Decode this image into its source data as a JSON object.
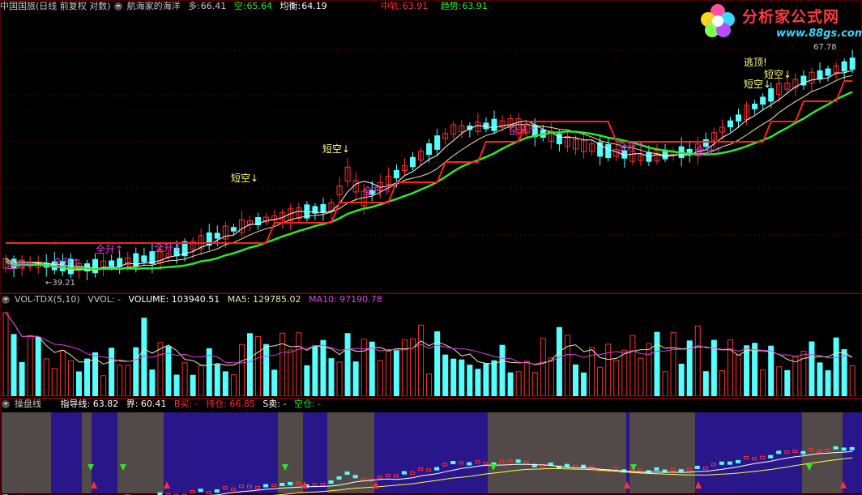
{
  "main": {
    "title": "中国国旅(日线 前复权 对数)",
    "indicator": "航海家的海洋",
    "long_label": "多:",
    "long_value": "66.41",
    "short_label": "空:",
    "short_value": "65.64",
    "balance_label": "均衡:",
    "balance_value": "64.19",
    "mid_label": "中轨:",
    "mid_value": "63.91",
    "trend_label": "趋势:",
    "trend_value": "63.91",
    "price_high": "67.78",
    "price_low": "←39.21",
    "notes": {
      "escape_top": "逃顶!",
      "short_sell": "短空↓",
      "full_rise": "全升↑"
    }
  },
  "volume": {
    "name": "VOL-TDX(5,10)",
    "vvol": "VVOL: -",
    "volume": "VOLUME: 103940.51",
    "ma5": "MA5: 129785.02",
    "ma10": "MA10: 97190.78"
  },
  "op": {
    "name": "操盘线",
    "guide": "指导线: 63.82",
    "bound": "界: 60.41",
    "buy": "B买: -",
    "hold": "持仓: 66.85",
    "sell": "S卖: -",
    "empty": "空仓: -"
  },
  "logo": {
    "name": "分析家公式网",
    "url": "www.88gs.com"
  },
  "colors": {
    "up": "#ff3030",
    "down": "#54ffff",
    "trend": "#ff2020",
    "green": "#2ee62e",
    "ma10": "#e040e0",
    "ma5": "#e8e8a0",
    "purple": "#28168a",
    "gray": "#524a48"
  }
}
